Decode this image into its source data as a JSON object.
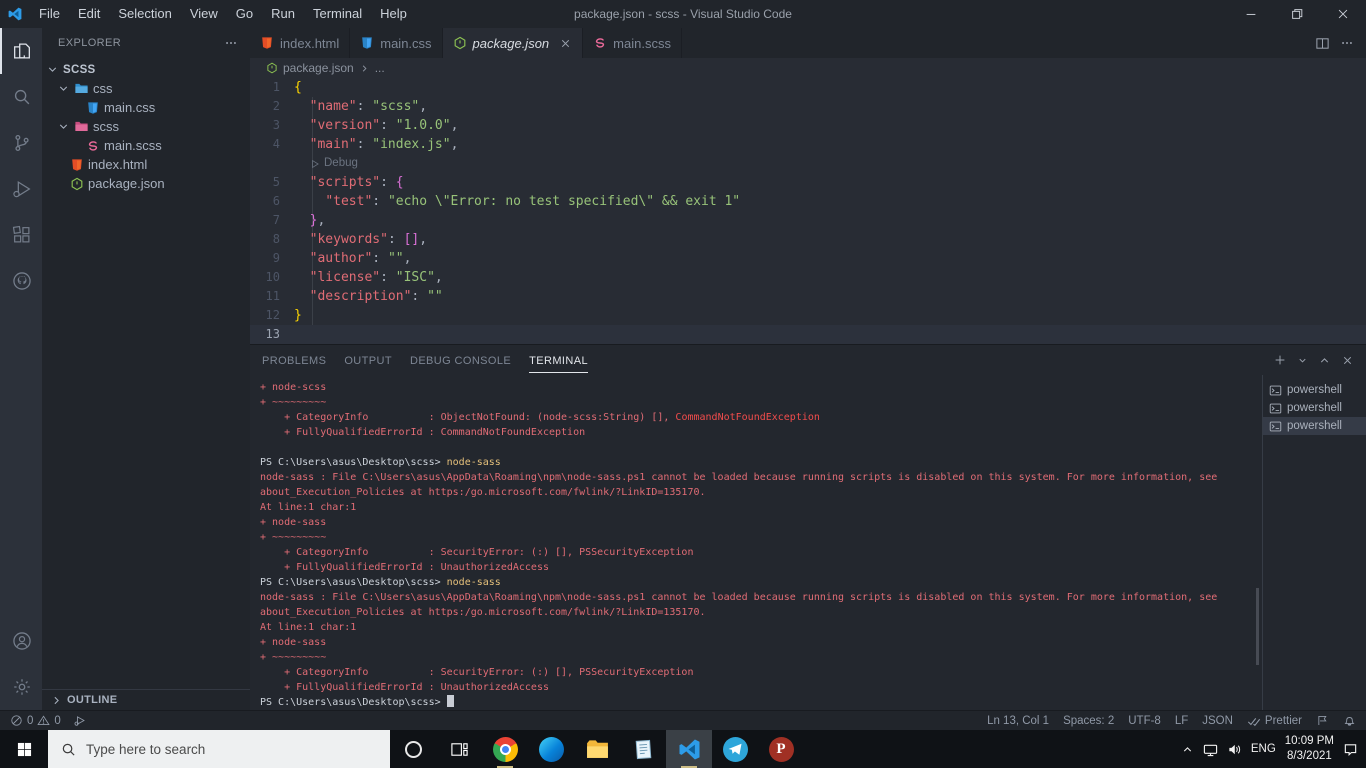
{
  "window": {
    "title": "package.json - scss - Visual Studio Code"
  },
  "menu_bar": {
    "items": [
      "File",
      "Edit",
      "Selection",
      "View",
      "Go",
      "Run",
      "Terminal",
      "Help"
    ]
  },
  "activity_bar": {
    "top": [
      {
        "icon": "files-icon",
        "active": true
      },
      {
        "icon": "search-icon"
      },
      {
        "icon": "source-control-icon"
      },
      {
        "icon": "run-debug-icon"
      },
      {
        "icon": "extensions-icon"
      },
      {
        "icon": "github-icon"
      }
    ],
    "bottom": [
      {
        "icon": "account-icon"
      },
      {
        "icon": "settings-gear-icon"
      }
    ]
  },
  "sidebar": {
    "header": "EXPLORER",
    "items": [
      {
        "label": "SCSS",
        "bold": true,
        "chevron": true,
        "pad": 4
      },
      {
        "label": "css",
        "chevron": true,
        "icon": "folder-css-icon",
        "pad": 15
      },
      {
        "label": "main.css",
        "icon": "css-icon",
        "pad": 44
      },
      {
        "label": "scss",
        "chevron": true,
        "icon": "folder-scss-icon",
        "pad": 15
      },
      {
        "label": "main.scss",
        "icon": "sass-icon",
        "pad": 44
      },
      {
        "label": "index.html",
        "icon": "html-icon",
        "pad": 28
      },
      {
        "label": "package.json",
        "icon": "json-icon",
        "pad": 28
      }
    ],
    "outline_label": "OUTLINE"
  },
  "tabs": [
    {
      "label": "index.html",
      "icon": "html-icon"
    },
    {
      "label": "main.css",
      "icon": "css-icon"
    },
    {
      "label": "package.json",
      "icon": "json-icon",
      "active": true
    },
    {
      "label": "main.scss",
      "icon": "sass-icon"
    }
  ],
  "breadcrumb": {
    "file": "package.json",
    "more": "..."
  },
  "colors": {
    "k": "#e06c75",
    "s": "#98c379",
    "p": "#abb2bf",
    "b1": "#ffd700",
    "b2": "#da70d6",
    "error": "#e06c75",
    "error_bright": "#f14c4c",
    "command": "#e5c07b"
  },
  "editor": {
    "lines": [
      {
        "n": "1",
        "seg": [
          [
            "b1",
            "{"
          ]
        ]
      },
      {
        "n": "2",
        "seg": [
          [
            "p",
            "  "
          ],
          [
            "k",
            "\"name\""
          ],
          [
            "p",
            ": "
          ],
          [
            "s",
            "\"scss\""
          ],
          [
            "p",
            ","
          ]
        ]
      },
      {
        "n": "3",
        "seg": [
          [
            "p",
            "  "
          ],
          [
            "k",
            "\"version\""
          ],
          [
            "p",
            ": "
          ],
          [
            "s",
            "\"1.0.0\""
          ],
          [
            "p",
            ","
          ]
        ]
      },
      {
        "n": "4",
        "seg": [
          [
            "p",
            "  "
          ],
          [
            "k",
            "\"main\""
          ],
          [
            "p",
            ": "
          ],
          [
            "s",
            "\"index.js\""
          ],
          [
            "p",
            ","
          ]
        ]
      },
      {
        "n": "",
        "codelens": "Debug"
      },
      {
        "n": "5",
        "seg": [
          [
            "p",
            "  "
          ],
          [
            "k",
            "\"scripts\""
          ],
          [
            "p",
            ": "
          ],
          [
            "b2",
            "{"
          ]
        ]
      },
      {
        "n": "6",
        "seg": [
          [
            "p",
            "    "
          ],
          [
            "k",
            "\"test\""
          ],
          [
            "p",
            ": "
          ],
          [
            "s",
            "\"echo \\\"Error: no test specified\\\" && exit 1\""
          ]
        ]
      },
      {
        "n": "7",
        "seg": [
          [
            "p",
            "  "
          ],
          [
            "b2",
            "}"
          ],
          [
            "p",
            ","
          ]
        ]
      },
      {
        "n": "8",
        "seg": [
          [
            "p",
            "  "
          ],
          [
            "k",
            "\"keywords\""
          ],
          [
            "p",
            ": "
          ],
          [
            "b2",
            "[]"
          ],
          [
            "p",
            ","
          ]
        ]
      },
      {
        "n": "9",
        "seg": [
          [
            "p",
            "  "
          ],
          [
            "k",
            "\"author\""
          ],
          [
            "p",
            ": "
          ],
          [
            "s",
            "\"\""
          ],
          [
            "p",
            ","
          ]
        ]
      },
      {
        "n": "10",
        "seg": [
          [
            "p",
            "  "
          ],
          [
            "k",
            "\"license\""
          ],
          [
            "p",
            ": "
          ],
          [
            "s",
            "\"ISC\""
          ],
          [
            "p",
            ","
          ]
        ]
      },
      {
        "n": "11",
        "seg": [
          [
            "p",
            "  "
          ],
          [
            "k",
            "\"description\""
          ],
          [
            "p",
            ": "
          ],
          [
            "s",
            "\"\""
          ]
        ]
      },
      {
        "n": "12",
        "seg": [
          [
            "b1",
            "}"
          ]
        ]
      },
      {
        "n": "13",
        "seg": [],
        "current": true
      }
    ]
  },
  "panel": {
    "tabs": [
      {
        "label": "PROBLEMS"
      },
      {
        "label": "OUTPUT"
      },
      {
        "label": "DEBUG CONSOLE"
      },
      {
        "label": "TERMINAL",
        "active": true
      }
    ]
  },
  "terminal": {
    "prompt": "PS C:\\Users\\asus\\Desktop\\scss> ",
    "sessions": [
      "powershell",
      "powershell",
      "powershell"
    ],
    "selected_session": 2,
    "lines": [
      {
        "k": "err",
        "t": "+ node-scss"
      },
      {
        "k": "err",
        "t": "+ ~~~~~~~~~"
      },
      {
        "k": "err",
        "t": "    + CategoryInfo          : ObjectNotFound: (node-scss:String) [], ",
        "hl": "CommandNotFoundException"
      },
      {
        "k": "err",
        "t": "    + FullyQualifiedErrorId : CommandNotFoundException"
      },
      {
        "k": "blank"
      },
      {
        "k": "cmd",
        "cmd": "node-sass"
      },
      {
        "k": "err",
        "t": "node-sass : File C:\\Users\\asus\\AppData\\Roaming\\npm\\node-sass.ps1 cannot be loaded because running scripts is disabled on this system. For more information, see"
      },
      {
        "k": "err",
        "t": "about_Execution_Policies at https:/go.microsoft.com/fwlink/?LinkID=135170."
      },
      {
        "k": "err",
        "t": "At line:1 char:1"
      },
      {
        "k": "err",
        "t": "+ node-sass"
      },
      {
        "k": "err",
        "t": "+ ~~~~~~~~~"
      },
      {
        "k": "err",
        "t": "    + CategoryInfo          : SecurityError: (:) [], PSSecurityException"
      },
      {
        "k": "err",
        "t": "    + FullyQualifiedErrorId : UnauthorizedAccess"
      },
      {
        "k": "cmd",
        "cmd": "node-sass"
      },
      {
        "k": "err",
        "t": "node-sass : File C:\\Users\\asus\\AppData\\Roaming\\npm\\node-sass.ps1 cannot be loaded because running scripts is disabled on this system. For more information, see"
      },
      {
        "k": "err",
        "t": "about_Execution_Policies at https:/go.microsoft.com/fwlink/?LinkID=135170."
      },
      {
        "k": "err",
        "t": "At line:1 char:1"
      },
      {
        "k": "err",
        "t": "+ node-sass"
      },
      {
        "k": "err",
        "t": "+ ~~~~~~~~~"
      },
      {
        "k": "err",
        "t": "    + CategoryInfo          : SecurityError: (:) [], PSSecurityException"
      },
      {
        "k": "err",
        "t": "    + FullyQualifiedErrorId : UnauthorizedAccess"
      },
      {
        "k": "cmd",
        "cursor": true
      }
    ]
  },
  "status_bar": {
    "errors": "0",
    "warnings": "0",
    "line_col": "Ln 13, Col 1",
    "spaces": "Spaces: 2",
    "encoding": "UTF-8",
    "eol": "LF",
    "language": "JSON",
    "formatter": "Prettier"
  },
  "taskbar": {
    "search_placeholder": "Type here to search",
    "apps": [
      {
        "icon": "cortana-icon"
      },
      {
        "icon": "task-view-icon"
      },
      {
        "icon": "chrome-icon",
        "running": true
      },
      {
        "icon": "edge-icon"
      },
      {
        "icon": "file-explorer-icon"
      },
      {
        "icon": "notepad-icon"
      },
      {
        "icon": "vscode-icon",
        "running": true,
        "focused": true
      },
      {
        "icon": "telegram-icon"
      },
      {
        "icon": "psiphon-icon"
      }
    ],
    "tray": {
      "language": "ENG",
      "time": "10:09 PM",
      "date": "8/3/2021"
    }
  }
}
